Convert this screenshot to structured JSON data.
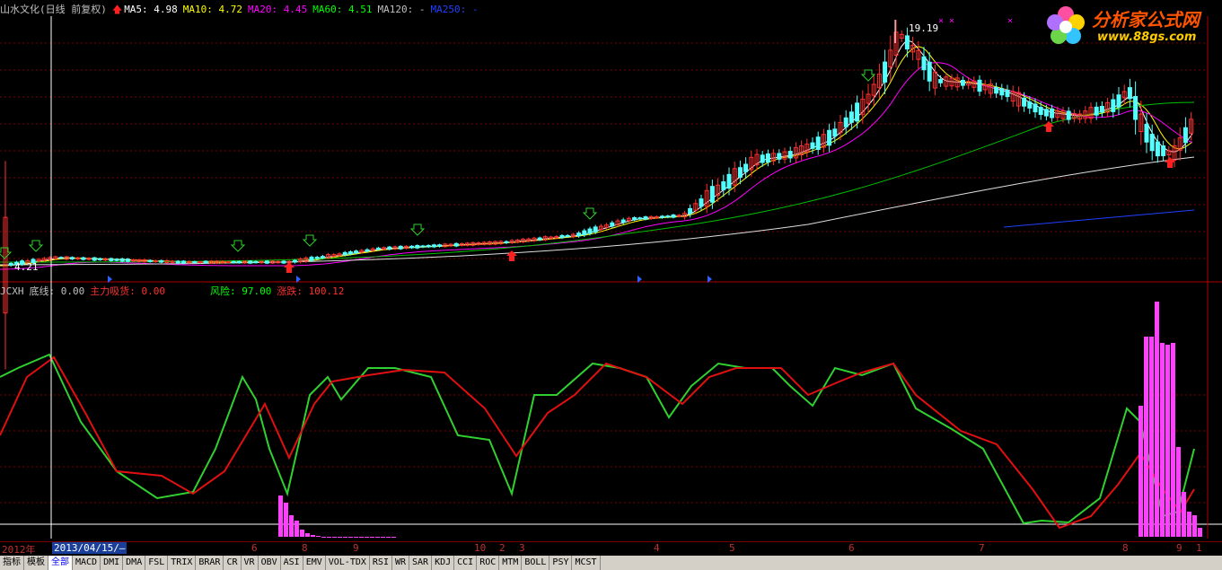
{
  "main_header": {
    "stock_title": "山水文化(日线 前复权)",
    "ma_items": [
      {
        "label": "MA5: 4.98",
        "color": "#ffffff"
      },
      {
        "label": "MA10: 4.72",
        "color": "#ffff00"
      },
      {
        "label": "MA20: 4.45",
        "color": "#ff00ff"
      },
      {
        "label": "MA60: 4.51",
        "color": "#00ff00"
      },
      {
        "label": "MA120: -",
        "color": "#c0c0c0"
      },
      {
        "label": "MA250: -",
        "color": "#2040ff"
      }
    ]
  },
  "price_labels": {
    "high": "19.19",
    "low": "4.21"
  },
  "indicator_header": {
    "name": "JCXH",
    "items": [
      {
        "label": "底线: 0.00",
        "color": "#c0c0c0"
      },
      {
        "label": "主力吸货: 0.00",
        "color": "#ff3030"
      },
      {
        "label": "风险: 97.00",
        "color": "#00ff00"
      },
      {
        "label": "涨跌: 100.12",
        "color": "#ff3030"
      }
    ]
  },
  "logo": {
    "brand": "分析家公式网",
    "url": "www.88gs.com"
  },
  "date_axis": {
    "cursor_date": "2013/04/15/—",
    "labels": [
      "2012年",
      "6",
      "8",
      "9",
      "10",
      "2",
      "3",
      "4",
      "5",
      "6",
      "7",
      "8",
      "9",
      "1"
    ]
  },
  "tabs": [
    "指标",
    "模板",
    "全部",
    "MACD",
    "DMI",
    "DMA",
    "FSL",
    "TRIX",
    "BRAR",
    "CR",
    "VR",
    "OBV",
    "ASI",
    "EMV",
    "VOL-TDX",
    "RSI",
    "WR",
    "SAR",
    "KDJ",
    "CCI",
    "ROC",
    "MTM",
    "BOLL",
    "PSY",
    "MCST"
  ],
  "colors": {
    "up": "#ff3030",
    "down": "#54ffff",
    "grid": "#7a0000",
    "green_line": "#30d030",
    "red_line": "#e01010",
    "bar": "#ff40ff"
  }
}
